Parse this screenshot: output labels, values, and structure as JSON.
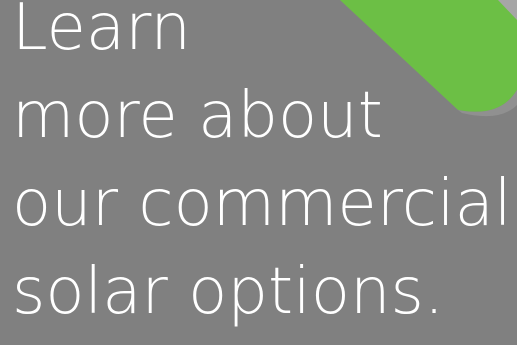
{
  "banner": {
    "lines": [
      "Learn",
      "more about",
      "our commercial",
      "solar options."
    ],
    "colors": {
      "background": "#808080",
      "text": "#ffffff",
      "accent": "#6cbf45",
      "accent_edge": "#a6a6a6"
    },
    "accent_shape": "green-corner-tab"
  }
}
